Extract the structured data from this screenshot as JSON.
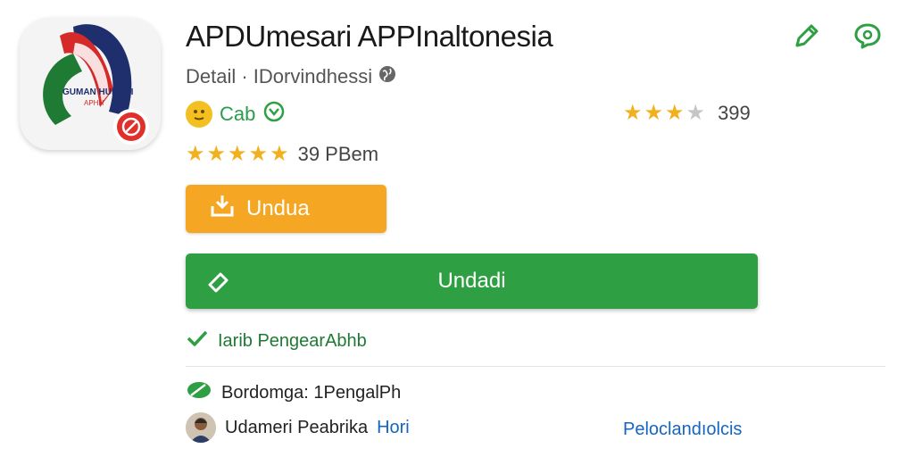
{
  "app": {
    "title": "APDUmesari APPInaltonesia",
    "subtitle": "Detail · IDorvindhessi",
    "icon_text": "GUMAN HUHUDI",
    "icon_subtext": "APHH"
  },
  "meta": {
    "label": "Cab"
  },
  "rating_top": {
    "stars": 3,
    "max": 4,
    "value": "399"
  },
  "rating_main": {
    "stars": 4.5,
    "max": 5,
    "value": "39 PBem"
  },
  "buttons": {
    "secondary_label": "Undua",
    "primary_label": "Undadi"
  },
  "verified": {
    "text": "Iarib PengearAbhb"
  },
  "developer": {
    "text": "Bordomga: 1PengalPh"
  },
  "publisher": {
    "name": "Udameri Peabrika",
    "link": "Hori",
    "right_link": "Peloclandıolcis"
  },
  "colors": {
    "accent_green": "#2ea043",
    "accent_orange": "#f5a623",
    "star": "#f2b01e",
    "link_blue": "#1565c0"
  }
}
